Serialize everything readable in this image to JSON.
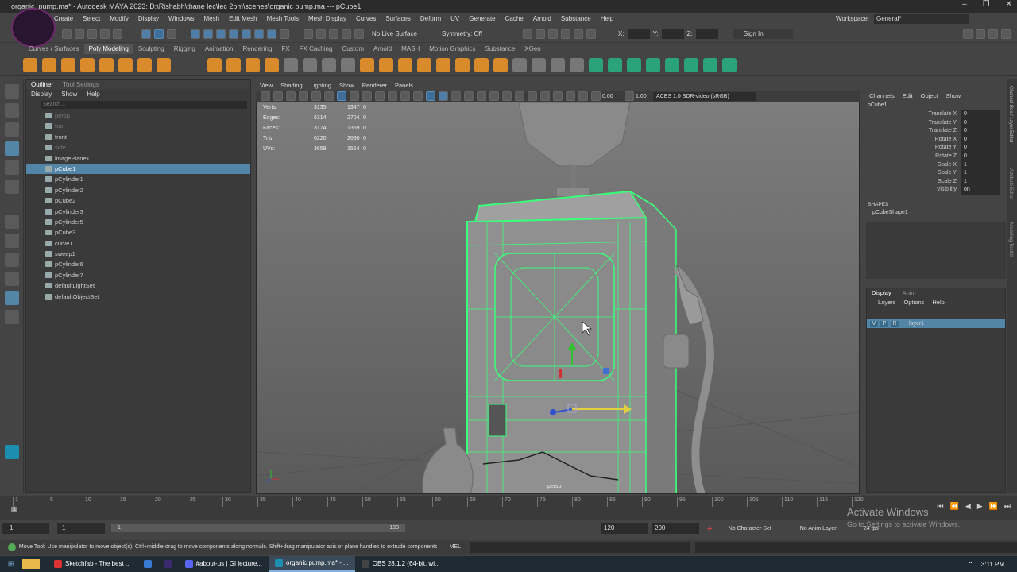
{
  "window": {
    "title": "organic_pump.ma* - Autodesk MAYA 2023: D:\\Rishabh\\thane lec\\lec 2pm\\scenes\\organic pump.ma  ---  pCube1",
    "controls": [
      "–",
      "❐",
      "✕"
    ]
  },
  "menubar": {
    "items": [
      "File",
      "Edit",
      "Create",
      "Select",
      "Modify",
      "Display",
      "Windows",
      "Mesh",
      "Edit Mesh",
      "Mesh Tools",
      "Mesh Display",
      "Curves",
      "Surfaces",
      "Deform",
      "UV",
      "Generate",
      "Cache",
      "Arnold",
      "Substance",
      "Help"
    ],
    "workspace_label": "Workspace:",
    "workspace_value": "General*"
  },
  "statusline": {
    "live_surface": "No Live Surface",
    "symmetry": "Symmetry: Off",
    "x_label": "X:",
    "y_label": "Y:",
    "z_label": "Z:",
    "sign_in": "Sign In"
  },
  "shelf": {
    "tabs": [
      "Curves / Surfaces",
      "Poly Modeling",
      "Sculpting",
      "Rigging",
      "Animation",
      "Rendering",
      "FX",
      "FX Caching",
      "Custom",
      "Arnold",
      "MASH",
      "Motion Graphics",
      "Substance",
      "XGen"
    ],
    "active_tab": "Poly Modeling"
  },
  "outliner": {
    "tabs": [
      "Outliner",
      "Tool Settings"
    ],
    "menu": [
      "Display",
      "Show",
      "Help"
    ],
    "search_placeholder": "Search...",
    "items": [
      {
        "label": "persp",
        "dim": true
      },
      {
        "label": "top",
        "dim": true
      },
      {
        "label": "front",
        "dim": false
      },
      {
        "label": "side",
        "dim": true
      },
      {
        "label": "imagePlane1",
        "dim": false
      },
      {
        "label": "pCube1",
        "dim": false,
        "selected": true
      },
      {
        "label": "pCylinder1",
        "dim": false
      },
      {
        "label": "pCylinder2",
        "dim": false
      },
      {
        "label": "pCube2",
        "dim": false
      },
      {
        "label": "pCylinder3",
        "dim": false
      },
      {
        "label": "pCylinder5",
        "dim": false
      },
      {
        "label": "pCube3",
        "dim": false
      },
      {
        "label": "curve1",
        "dim": false
      },
      {
        "label": "sweep1",
        "dim": false
      },
      {
        "label": "pCylinder6",
        "dim": false
      },
      {
        "label": "pCylinder7",
        "dim": false
      },
      {
        "label": "defaultLightSet",
        "dim": false
      },
      {
        "label": "defaultObjectSet",
        "dim": false
      }
    ]
  },
  "viewport": {
    "menu": [
      "View",
      "Shading",
      "Lighting",
      "Show",
      "Renderer",
      "Panels"
    ],
    "exposure": "0.00",
    "gamma": "1.00",
    "color_space": "ACES 1.0 SDR-video (sRGB)",
    "camera_label": "persp",
    "hud": [
      {
        "name": "Verts:",
        "a": "3135",
        "b": "1347",
        "c": "0"
      },
      {
        "name": "Edges:",
        "a": "6314",
        "b": "2704",
        "c": "0"
      },
      {
        "name": "Faces:",
        "a": "3174",
        "b": "1359",
        "c": "0"
      },
      {
        "name": "Tris:",
        "a": "6220",
        "b": "2690",
        "c": "0"
      },
      {
        "name": "UVs:",
        "a": "3659",
        "b": "1554",
        "c": "0"
      }
    ]
  },
  "channelbox": {
    "menu": [
      "Channels",
      "Edit",
      "Object",
      "Show"
    ],
    "object": "pCube1",
    "attributes": [
      {
        "name": "Translate X",
        "value": "0"
      },
      {
        "name": "Translate Y",
        "value": "0"
      },
      {
        "name": "Translate Z",
        "value": "0"
      },
      {
        "name": "Rotate X",
        "value": "0"
      },
      {
        "name": "Rotate Y",
        "value": "0"
      },
      {
        "name": "Rotate Z",
        "value": "0"
      },
      {
        "name": "Scale X",
        "value": "1"
      },
      {
        "name": "Scale Y",
        "value": "1"
      },
      {
        "name": "Scale Z",
        "value": "1"
      },
      {
        "name": "Visibility",
        "value": "on"
      }
    ],
    "shapes_header": "SHAPES",
    "shape": "pCubeShape1",
    "side_tabs": [
      "Channel Box / Layer Editor",
      "Attribute Editor",
      "Modeling Toolkit"
    ]
  },
  "layers": {
    "tabs": [
      "Display",
      "Anim"
    ],
    "menu": [
      "Layers",
      "Options",
      "Help"
    ],
    "layer": {
      "v": "V",
      "p": "P",
      "r": "R",
      "name": "layer1"
    }
  },
  "timeline": {
    "ticks": [
      "1",
      "5",
      "10",
      "15",
      "20",
      "25",
      "30",
      "35",
      "40",
      "45",
      "50",
      "55",
      "60",
      "65",
      "70",
      "75",
      "80",
      "85",
      "90",
      "95",
      "100",
      "105",
      "110",
      "115",
      "120"
    ],
    "current": "1"
  },
  "range": {
    "start": "1",
    "start2": "1",
    "slider_start": "1",
    "slider_end": "120",
    "end": "120",
    "end2": "200",
    "character_set": "No Character Set",
    "anim_layer": "No Anim Layer",
    "fps": "24 fps"
  },
  "helpline": {
    "text": "Move Tool: Use manipulator to move object(s). Ctrl+middle-drag to move components along normals. Shift+drag manipulator axis or plane handles to extrude components or c",
    "mel": "MEL"
  },
  "watermark": {
    "line1": "Activate Windows",
    "line2": "Go to Settings to activate Windows."
  },
  "taskbar": {
    "items": [
      {
        "label": "Sketchfab - The best ...",
        "color": "#d33"
      },
      {
        "label": "",
        "color": "#3a7bd5"
      },
      {
        "label": "",
        "color": "#3b2a70"
      },
      {
        "label": "#about-us | GI lecture...",
        "color": "#5865f2"
      },
      {
        "label": "organic pump.ma* - ...",
        "color": "#1c8fb0",
        "active": true
      },
      {
        "label": "OBS 28.1.2 (64-bit, wi...",
        "color": "#444"
      }
    ],
    "time": "3:11 PM"
  },
  "colors": {
    "selection": "#5285a6",
    "wireframe": "#39ff7a",
    "shelf_orange": "#d98a2b"
  }
}
